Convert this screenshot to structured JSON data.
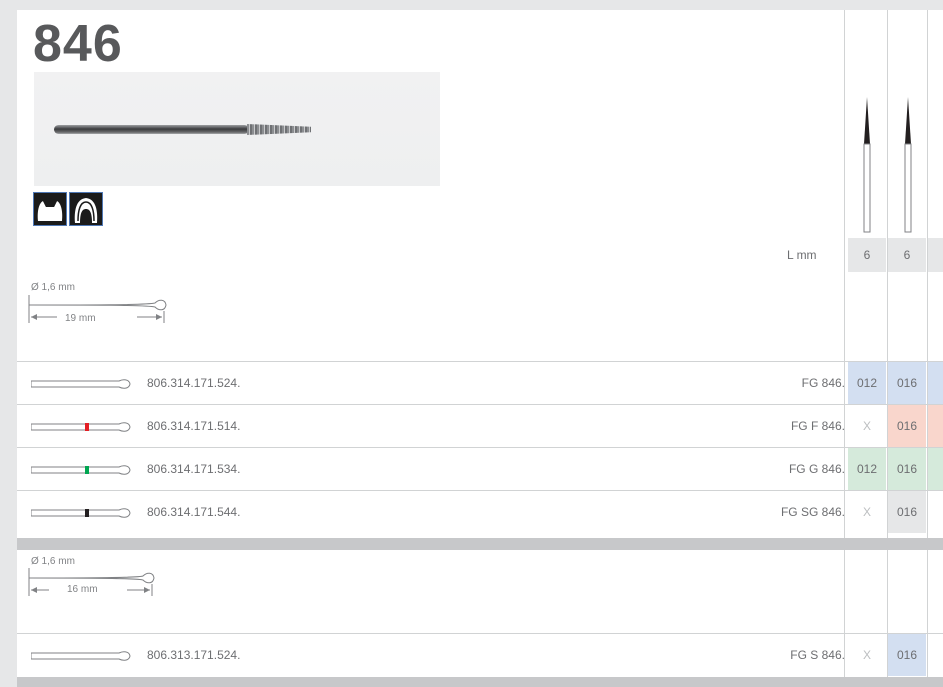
{
  "title": "846",
  "lmm": {
    "label": "L mm",
    "values": [
      "6",
      "6"
    ]
  },
  "dims": [
    {
      "diameter": "Ø 1,6 mm",
      "length": "19 mm"
    },
    {
      "diameter": "Ø 1,6 mm",
      "length": "16 mm"
    }
  ],
  "rows": [
    {
      "catalog": "806.314.171.524.",
      "fg": "FG 846.",
      "stripe": "",
      "cells": [
        "012",
        "016"
      ],
      "colors": [
        "#d3dff1",
        "#d3dff1"
      ]
    },
    {
      "catalog": "806.314.171.514.",
      "fg": "FG F 846.",
      "stripe": "#e31e24",
      "cells": [
        "X",
        "016"
      ],
      "colors": [
        "#ffffff",
        "#f9d6cc"
      ]
    },
    {
      "catalog": "806.314.171.534.",
      "fg": "FG G 846.",
      "stripe": "#00a651",
      "cells": [
        "012",
        "016"
      ],
      "colors": [
        "#d5eadb",
        "#d5eadb"
      ]
    },
    {
      "catalog": "806.314.171.544.",
      "fg": "FG SG 846.",
      "stripe": "#231f20",
      "cells": [
        "X",
        "016"
      ],
      "colors": [
        "#ffffff",
        "#e6e7e8"
      ]
    },
    {
      "catalog": "806.313.171.524.",
      "fg": "FG S 846.",
      "stripe": "",
      "cells": [
        "X",
        "016"
      ],
      "colors": [
        "#ffffff",
        "#d3dff1"
      ]
    }
  ],
  "icons": [
    "crown-prep-icon",
    "tooth-icon"
  ]
}
